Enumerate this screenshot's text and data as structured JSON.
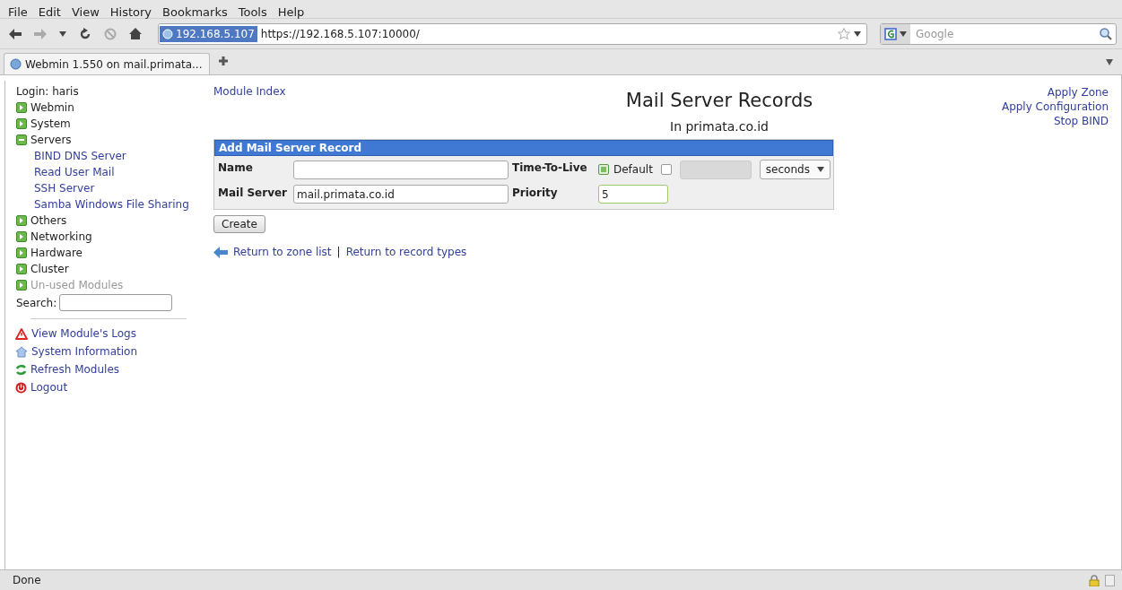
{
  "menu": [
    "File",
    "Edit",
    "View",
    "History",
    "Bookmarks",
    "Tools",
    "Help"
  ],
  "address": {
    "site": "192.168.5.107",
    "url": "https://192.168.5.107:10000/"
  },
  "search": {
    "placeholder": "Google"
  },
  "tabs": [
    {
      "label": "Webmin 1.550 on mail.primata...",
      "selected": true
    }
  ],
  "sidebar": {
    "login": "Login: haris",
    "categories": [
      {
        "label": "Webmin",
        "expanded": false,
        "disabled": false
      },
      {
        "label": "System",
        "expanded": false,
        "disabled": false
      },
      {
        "label": "Servers",
        "expanded": true,
        "disabled": false,
        "children": [
          "BIND DNS Server",
          "Read User Mail",
          "SSH Server",
          "Samba Windows File Sharing"
        ]
      },
      {
        "label": "Others",
        "expanded": false,
        "disabled": false
      },
      {
        "label": "Networking",
        "expanded": false,
        "disabled": false
      },
      {
        "label": "Hardware",
        "expanded": false,
        "disabled": false
      },
      {
        "label": "Cluster",
        "expanded": false,
        "disabled": false
      },
      {
        "label": "Un-used Modules",
        "expanded": false,
        "disabled": true
      }
    ],
    "search_label": "Search:",
    "links": [
      {
        "label": "View Module's Logs",
        "kind": "warning"
      },
      {
        "label": "System Information",
        "kind": "info"
      },
      {
        "label": "Refresh Modules",
        "kind": "refresh"
      },
      {
        "label": "Logout",
        "kind": "logout"
      }
    ]
  },
  "main": {
    "module_index": "Module Index",
    "title": "Mail Server Records",
    "subtitle": "In primata.co.id",
    "right_links": [
      "Apply Zone",
      "Apply Configuration",
      "Stop BIND"
    ],
    "form": {
      "header": "Add Mail Server Record",
      "name_label": "Name",
      "ttl_label": "Time-To-Live",
      "ttl_default_label": "Default",
      "ttl_default_checked": true,
      "ttl_custom_checked": false,
      "ttl_unit": "seconds",
      "server_label": "Mail Server",
      "server_value": "mail.primata.co.id",
      "priority_label": "Priority",
      "priority_value": "5"
    },
    "create": "Create",
    "footer_links": [
      "Return to zone list",
      "Return to record types"
    ],
    "separator": "|"
  },
  "status": "Done"
}
